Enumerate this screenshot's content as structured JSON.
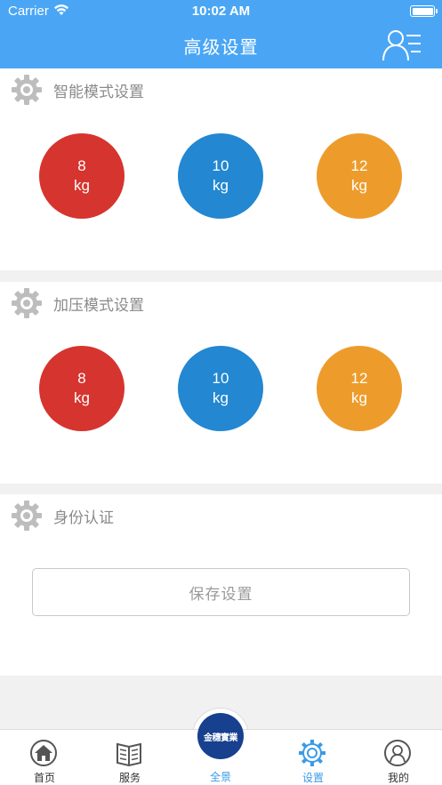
{
  "status_bar": {
    "carrier": "Carrier",
    "time": "10:02 AM"
  },
  "nav_bar": {
    "title": "高级设置",
    "right_icon": "user-list-icon"
  },
  "sections": {
    "smart": {
      "title": "智能模式设置",
      "icon": "gear-icon",
      "weights": [
        {
          "value": "8",
          "unit": "kg",
          "color": "#d6342e"
        },
        {
          "value": "10",
          "unit": "kg",
          "color": "#2387d1"
        },
        {
          "value": "12",
          "unit": "kg",
          "color": "#ed9c2c"
        }
      ]
    },
    "pressure": {
      "title": "加压模式设置",
      "icon": "gear-icon",
      "weights": [
        {
          "value": "8",
          "unit": "kg",
          "color": "#d6342e"
        },
        {
          "value": "10",
          "unit": "kg",
          "color": "#2387d1"
        },
        {
          "value": "12",
          "unit": "kg",
          "color": "#ed9c2c"
        }
      ]
    },
    "identity": {
      "title": "身份认证",
      "icon": "gear-icon",
      "save_label": "保存设置"
    }
  },
  "tab_bar": {
    "tabs": [
      {
        "label": "首页",
        "icon": "home-icon"
      },
      {
        "label": "服务",
        "icon": "book-icon"
      },
      {
        "label": "全景",
        "icon": "brand-logo",
        "logo_text": "金穗實業"
      },
      {
        "label": "设置",
        "icon": "gear-icon"
      },
      {
        "label": "我的",
        "icon": "profile-icon"
      }
    ],
    "active_index": 2,
    "active_color": "#3a9be6"
  },
  "colors": {
    "primary": "#4aa6f5",
    "red": "#d6342e",
    "blue": "#2387d1",
    "orange": "#ed9c2c"
  }
}
